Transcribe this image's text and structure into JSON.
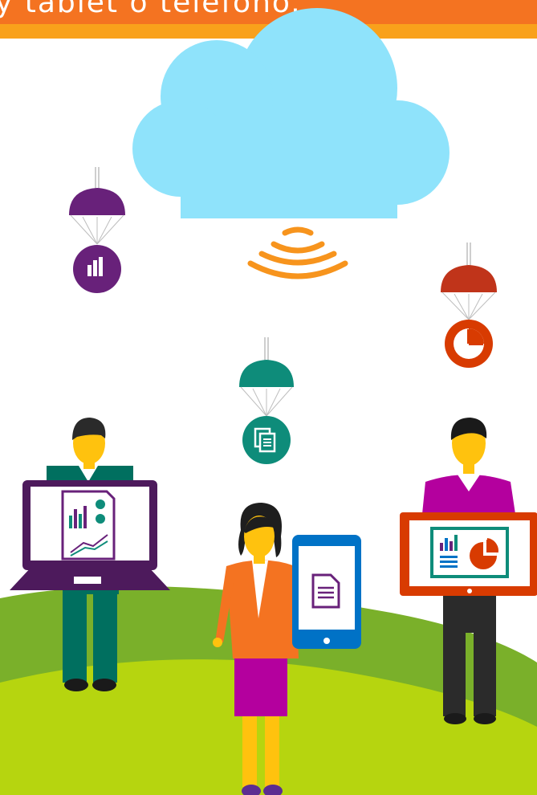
{
  "banner": {
    "text": "y tablet o teléfono.",
    "bg_color": "#f47321",
    "stripe_color": "#f9a11b"
  },
  "colors": {
    "cloud": "#8fe3fb",
    "signal": "#f7941d",
    "hill_back": "#7ab02a",
    "hill_front": "#b6d50f",
    "purple": "#68217a",
    "red": "#d83b01",
    "teal": "#0e8c7a",
    "skin": "#ffc20e"
  },
  "icons": [
    "cloud-icon",
    "wifi-signal-icon",
    "bar-chart-icon",
    "pie-chart-icon",
    "document-icon"
  ]
}
